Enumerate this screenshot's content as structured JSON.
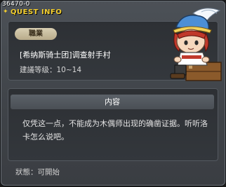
{
  "quest_id": "36470-0",
  "window_title": "QUEST INFO",
  "job_badge": "職業",
  "quest_name": "[希纳斯骑士团]调查射手村",
  "quest_level": "建議等级：10~14",
  "content_title": "内容",
  "content_text": "仅凭这一点，不能成为木偶师出现的确凿证据。听听洛卡怎么说吧。",
  "status": "狀態：可開始",
  "colors": {
    "title": "#f4cf2e",
    "badge_bg": "#c9bd9d"
  }
}
